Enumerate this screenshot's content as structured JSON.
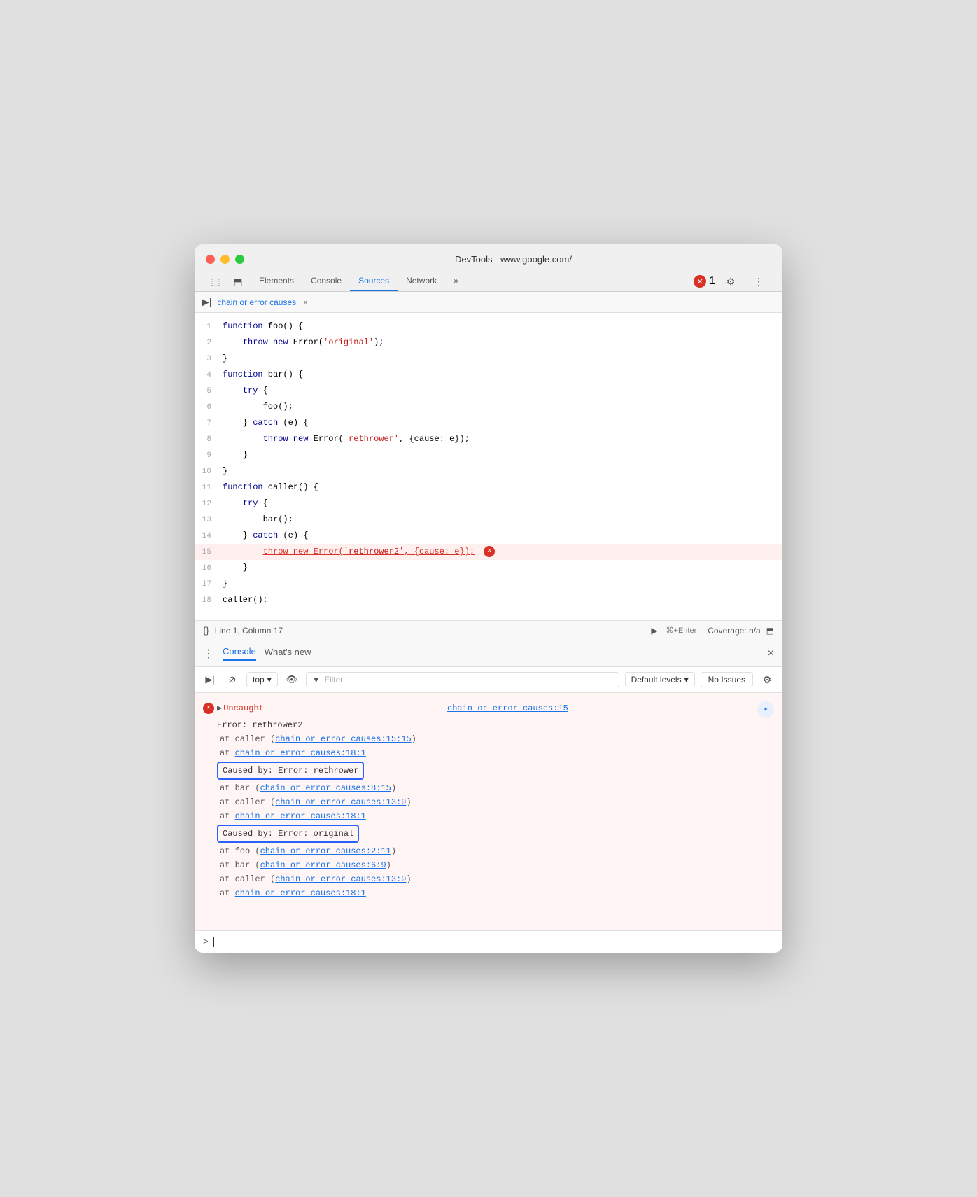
{
  "window": {
    "title": "DevTools - www.google.com/",
    "traffic_lights": [
      "close",
      "minimize",
      "maximize"
    ]
  },
  "devtools": {
    "tabs": [
      {
        "label": "Elements",
        "active": false
      },
      {
        "label": "Console",
        "active": false
      },
      {
        "label": "Sources",
        "active": true
      },
      {
        "label": "Network",
        "active": false
      },
      {
        "label": "»",
        "active": false
      }
    ],
    "error_count": "1",
    "icons": {
      "inspector": "⬚",
      "device": "⬒",
      "more_vert": "⋮",
      "settings": "⚙"
    }
  },
  "sources": {
    "panel_toggle": "▶",
    "file_name": "chain or error causes",
    "close_label": "×"
  },
  "code": {
    "lines": [
      {
        "num": 1,
        "content": "function foo() {",
        "error": false
      },
      {
        "num": 2,
        "content": "    throw new Error('original');",
        "error": false
      },
      {
        "num": 3,
        "content": "}",
        "error": false
      },
      {
        "num": 4,
        "content": "function bar() {",
        "error": false
      },
      {
        "num": 5,
        "content": "    try {",
        "error": false
      },
      {
        "num": 6,
        "content": "        foo();",
        "error": false
      },
      {
        "num": 7,
        "content": "    } catch (e) {",
        "error": false
      },
      {
        "num": 8,
        "content": "        throw new Error('rethrower', {cause: e});",
        "error": false
      },
      {
        "num": 9,
        "content": "    }",
        "error": false
      },
      {
        "num": 10,
        "content": "}",
        "error": false
      },
      {
        "num": 11,
        "content": "function caller() {",
        "error": false
      },
      {
        "num": 12,
        "content": "    try {",
        "error": false
      },
      {
        "num": 13,
        "content": "        bar();",
        "error": false
      },
      {
        "num": 14,
        "content": "    } catch (e) {",
        "error": false
      },
      {
        "num": 15,
        "content": "        throw new Error('rethrower2', {cause: e}); ●",
        "error": true
      },
      {
        "num": 16,
        "content": "    }",
        "error": false
      },
      {
        "num": 17,
        "content": "}",
        "error": false
      },
      {
        "num": 18,
        "content": "caller();",
        "error": false
      }
    ]
  },
  "status_bar": {
    "format_label": "{}",
    "line_col": "Line 1, Column 17",
    "run_label": "▶",
    "shortcut": "⌘+Enter",
    "coverage": "Coverage: n/a",
    "screenshot_icon": "⬒"
  },
  "console": {
    "tab_label": "Console",
    "whats_new_label": "What's new",
    "close_icon": "×",
    "toolbar": {
      "panel_icon": "▶",
      "clear_icon": "⊘",
      "top_label": "top",
      "dropdown_arrow": "▾",
      "eye_icon": "👁",
      "filter_icon": "▼",
      "filter_placeholder": "Filter",
      "default_levels": "Default levels",
      "no_issues": "No Issues",
      "gear_icon": "⚙"
    },
    "output": {
      "error_header": "Uncaught",
      "error_link": "chain or error causes:15",
      "error_line1": "Error: rethrower2",
      "stack1": "    at caller (chain or error causes:15:15)",
      "stack2": "    at chain or error causes:18:1",
      "caused_by1": "Caused by: Error: rethrower",
      "caused_by1_stack1": "    at bar (chain or error causes:8:15)",
      "caused_by1_stack2": "    at caller (chain or error causes:13:9)",
      "caused_by1_stack3": "    at chain or error causes:18:1",
      "caused_by2": "Caused by: Error: original",
      "caused_by2_stack1": "    at foo (chain or error causes:2:11)",
      "caused_by2_stack2": "    at bar (chain or error causes:6:9)",
      "caused_by2_stack3": "    at caller (chain or error causes:13:9)",
      "caused_by2_stack4": "    at chain or error causes:18:1"
    },
    "links": {
      "header_link": "chain or error causes:15",
      "link1": "chain or error causes:15:15",
      "link2": "chain or error causes:18:1",
      "link3": "chain or error causes:8:15",
      "link4": "chain or error causes:13:9",
      "link5": "chain or error causes:18:1",
      "link6": "chain or error causes:2:11",
      "link7": "chain or error causes:6:9",
      "link8": "chain or error causes:13:9",
      "link9": "chain or error causes:18:1"
    }
  }
}
